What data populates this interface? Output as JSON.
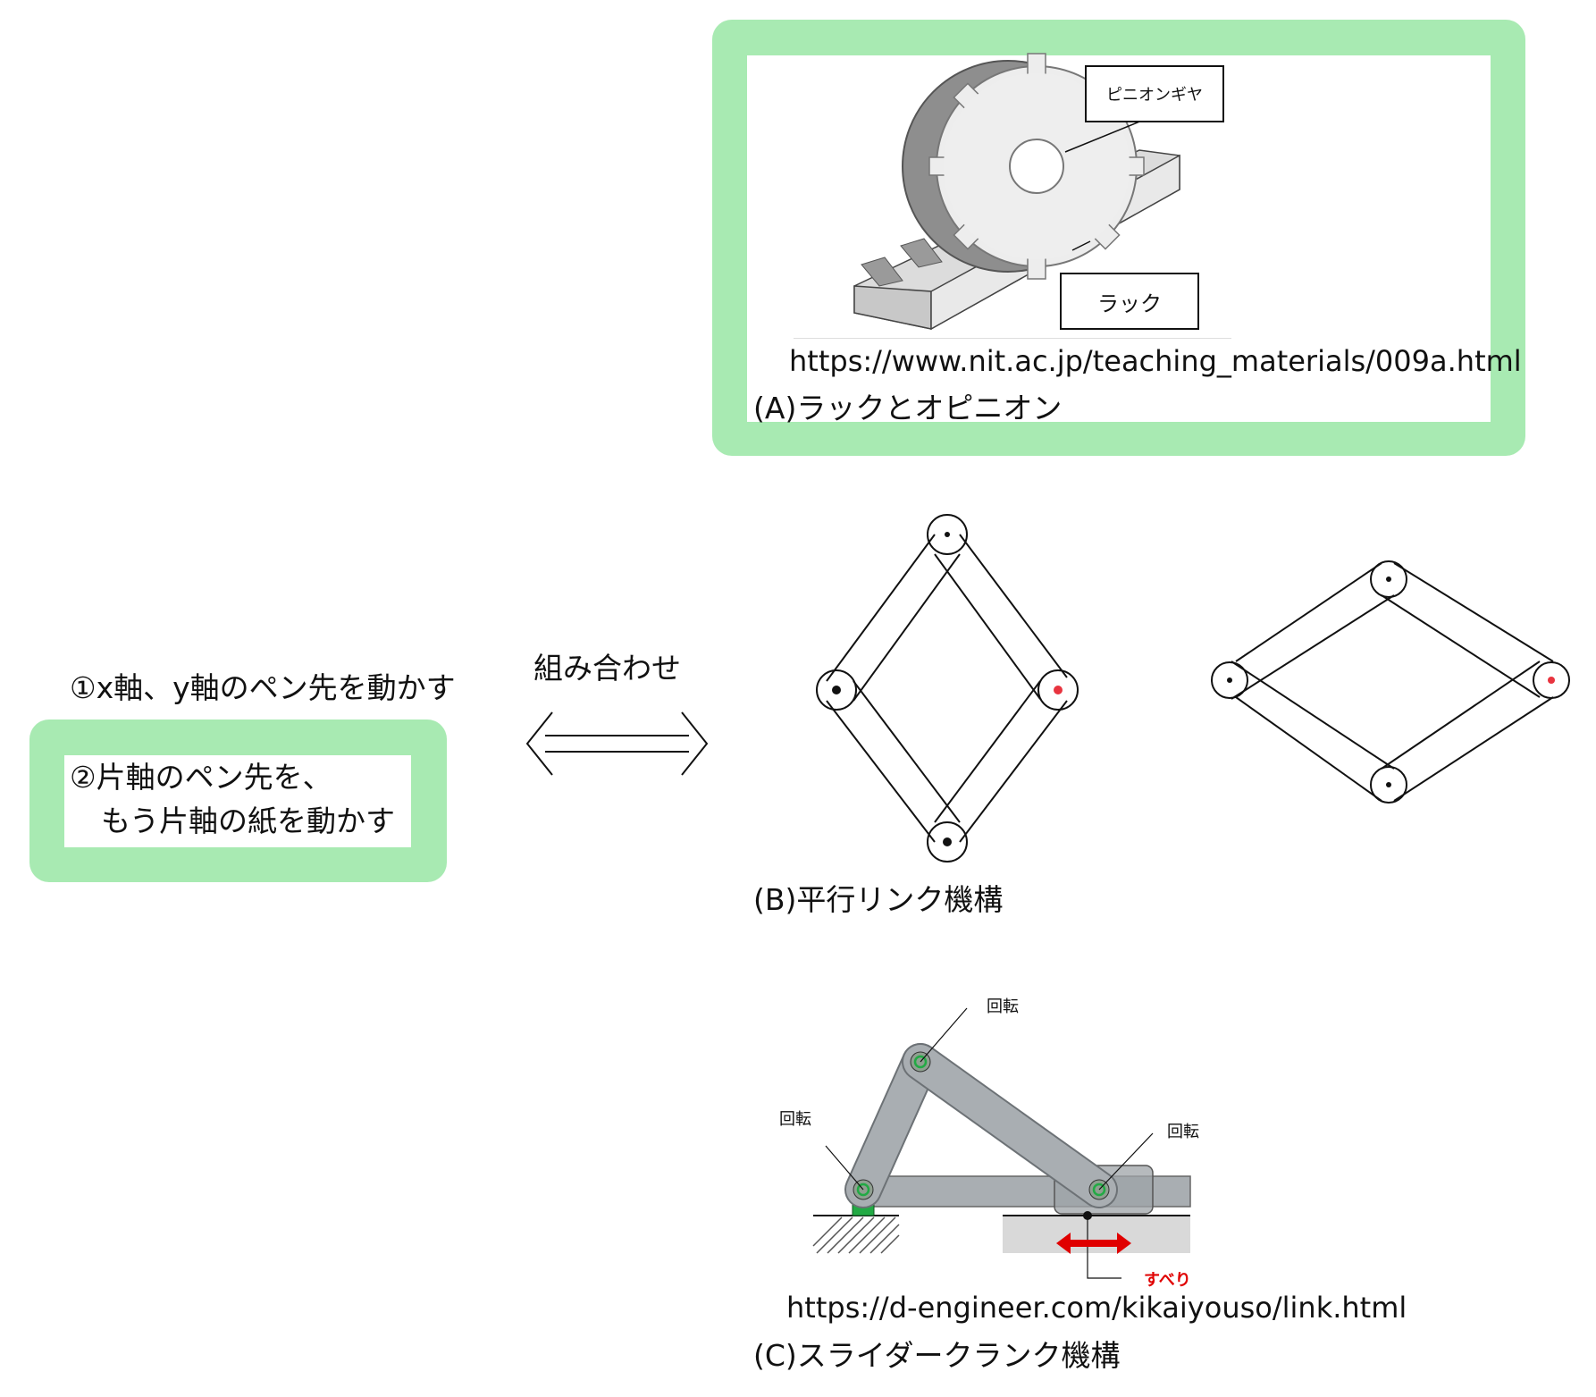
{
  "left": {
    "item1": "①x軸、y軸のペン先を動かす",
    "item2_line1": "②片軸のペン先を、",
    "item2_line2": "もう片軸の紙を動かす",
    "combine_label": "組み合わせ"
  },
  "figA": {
    "pinion_label": "ピニオンギヤ",
    "rack_label": "ラック",
    "url": "https://www.nit.ac.jp/teaching_materials/009a.html",
    "caption": "(A)ラックとオピニオン"
  },
  "figB": {
    "caption": "(B)平行リンク機構"
  },
  "figC": {
    "rot_top": "回転",
    "rot_left": "回転",
    "rot_right": "回転",
    "slide": "すべり",
    "url": "https://d-engineer.com/kikaiyouso/link.html",
    "caption": "(C)スライダークランク機構"
  },
  "colors": {
    "frame_green": "#a8eab2",
    "pin_red": "#e8343f",
    "joint_green": "#22aa44",
    "arrow_red": "#e00000"
  }
}
